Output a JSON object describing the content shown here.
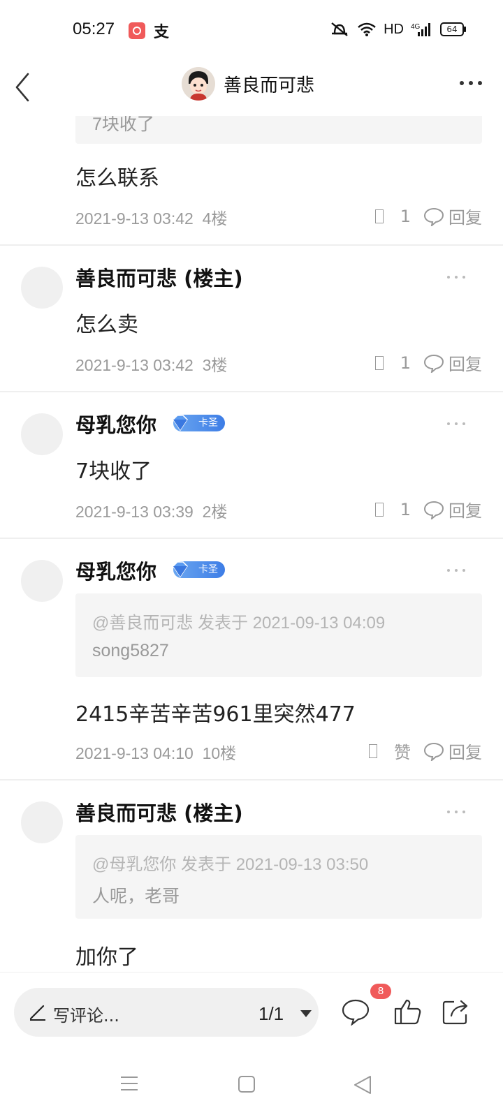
{
  "status": {
    "time": "05:27",
    "network": "HD",
    "signal": "4G",
    "battery": "64"
  },
  "header": {
    "title": "善良而可悲"
  },
  "posts": [
    {
      "quote_tail": "7块收了",
      "text": "怎么联系",
      "time": "2021-9-13 03:42",
      "floor": "4楼",
      "likes": "1",
      "reply": "回复"
    },
    {
      "user": "善良而可悲 (楼主)",
      "text": "怎么卖",
      "time": "2021-9-13 03:42",
      "floor": "3楼",
      "likes": "1",
      "reply": "回复"
    },
    {
      "user": "母乳您你",
      "badge": "卡圣",
      "text": "7块收了",
      "time": "2021-9-13 03:39",
      "floor": "2楼",
      "likes": "1",
      "reply": "回复"
    },
    {
      "user": "母乳您你",
      "badge": "卡圣",
      "quote_head": "@善良而可悲 发表于 2021-09-13 04:09",
      "quote_body": "song5827",
      "text": "2415辛苦辛苦961里突然477",
      "time": "2021-9-13 04:10",
      "floor": "10楼",
      "likes": "赞",
      "reply": "回复"
    },
    {
      "user": "善良而可悲 (楼主)",
      "quote_head": "@母乳您你 发表于 2021-09-13 03:50",
      "quote_body": "人呢，老哥",
      "text": "加你了"
    }
  ],
  "bottom": {
    "placeholder": "写评论...",
    "page": "1/1",
    "comment_count": "8"
  },
  "colors": {
    "accent_red": "#f05a5a",
    "badge_blue": "#3d7de6"
  }
}
